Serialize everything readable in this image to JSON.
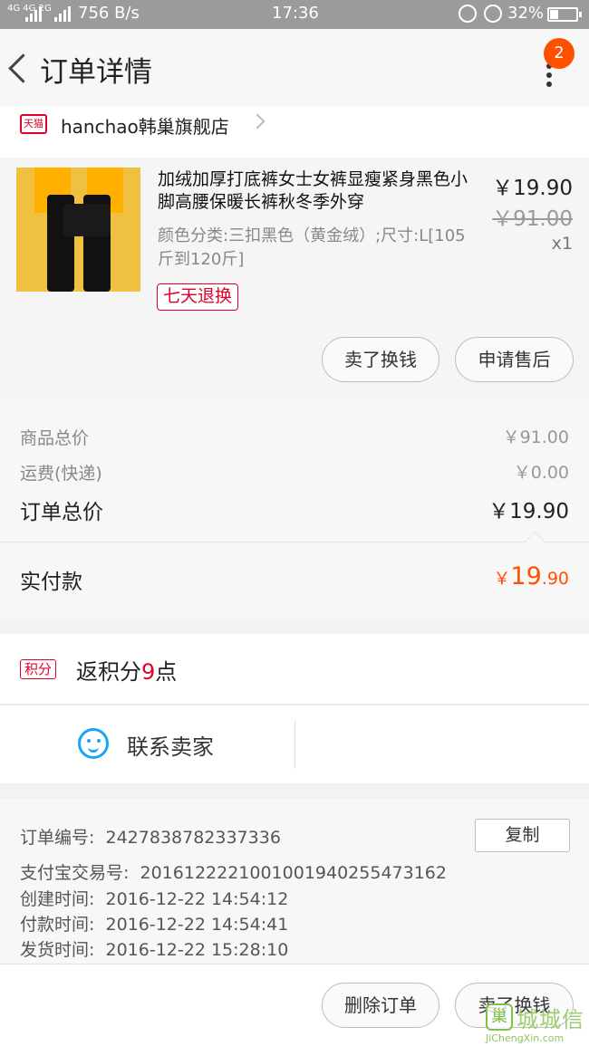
{
  "status_bar": {
    "network": "4G 4G 2G",
    "speed": "756 B/s",
    "time": "17:36",
    "battery": "32%"
  },
  "header": {
    "title": "订单详情",
    "badge_count": "2"
  },
  "shop": {
    "platform_tag": "天猫",
    "name": "hanchao韩巢旗舰店"
  },
  "item": {
    "title": "加绒加厚打底裤女士女裤显瘦紧身黑色小脚高腰保暖长裤秋冬季外穿",
    "price": "￥19.90",
    "original_price": "￥91.00",
    "quantity": "x1",
    "sku": "颜色分类:三扣黑色（黄金绒）;尺寸:L[105斤到120斤]",
    "return_tag": "七天退换",
    "buttons": [
      "卖了换钱",
      "申请售后"
    ]
  },
  "totals": {
    "goods_label": "商品总价",
    "goods_value": "￥91.00",
    "shipping_label": "运费(快递)",
    "shipping_value": "￥0.00",
    "order_label": "订单总价",
    "order_value": "￥19.90",
    "paid_label": "实付款",
    "paid_currency": "￥",
    "paid_int": "19",
    "paid_dec": ".90"
  },
  "points": {
    "tag": "积分",
    "prefix": "返积分",
    "count": "9",
    "suffix": "点"
  },
  "contact": {
    "label": "联系卖家"
  },
  "order_info": {
    "order_no_label": "订单编号:",
    "order_no": "2427838782337336",
    "copy_label": "复制",
    "alipay_label": "支付宝交易号:",
    "alipay_no": "2016122221001001940255473162",
    "created_label": "创建时间:",
    "created": "2016-12-22 14:54:12",
    "paid_label": "付款时间:",
    "paid": "2016-12-22 14:54:41",
    "shipped_label": "发货时间:",
    "shipped": "2016-12-22 15:28:10"
  },
  "bottom": {
    "delete_label": "删除订单",
    "sell_label": "卖了换钱"
  },
  "watermark": {
    "logo": "巢",
    "name": "城城信",
    "url": "JiChengXin.com"
  },
  "colors": {
    "accent": "#ff5000",
    "tmall_red": "#e0002a",
    "wangwang_blue": "#19a5f5"
  }
}
